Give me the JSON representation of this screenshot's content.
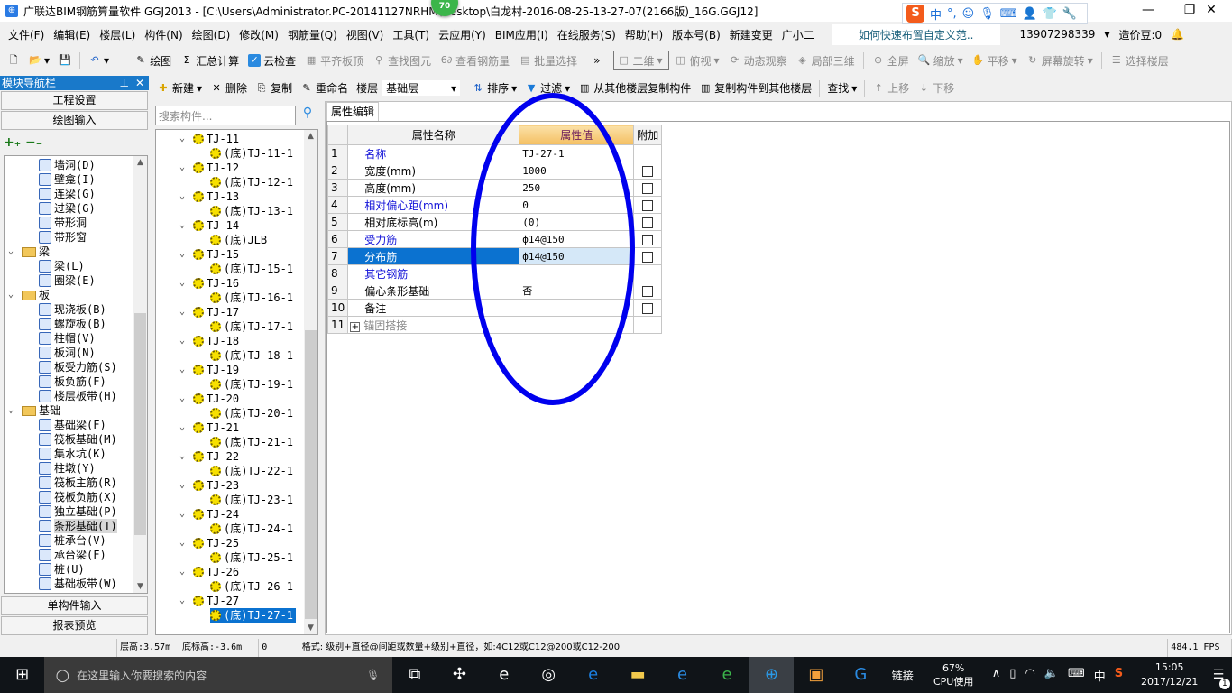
{
  "title": "广联达BIM钢筋算量软件 GGJ2013 - [C:\\Users\\Administrator.PC-20141127NRHM\\Desktop\\白龙村-2016-08-25-13-27-07(2166版)_16G.GGJ12]",
  "badge": "70",
  "ime": {
    "mode": "中",
    "punct": "°,"
  },
  "menu": [
    "文件(F)",
    "编辑(E)",
    "楼层(L)",
    "构件(N)",
    "绘图(D)",
    "修改(M)",
    "钢筋量(Q)",
    "视图(V)",
    "工具(T)",
    "云应用(Y)",
    "BIM应用(I)",
    "在线服务(S)",
    "帮助(H)",
    "版本号(B)",
    "新建变更",
    "广小二"
  ],
  "menu_tip": "如何快速布置自定义范..",
  "account": {
    "phone": "13907298339",
    "beans": "造价豆:0"
  },
  "toolbar1": {
    "draw": "绘图",
    "sum": "汇总计算",
    "cloudcheck": "云检查",
    "align": "平齐板顶",
    "find": "查找图元",
    "viewrebar": "查看钢筋量",
    "batch": "批量选择",
    "view2d": "二维",
    "top": "俯视",
    "dynamic": "动态观察",
    "local3d": "局部三维",
    "fullscreen": "全屏",
    "zoom": "缩放",
    "pan": "平移",
    "rotate": "屏幕旋转",
    "selfloor": "选择楼层"
  },
  "nav": {
    "title": "模块导航栏",
    "project": "工程设置",
    "drawing": "绘图输入",
    "single": "单构件输入",
    "report": "报表预览",
    "tree": [
      {
        "label": "墙洞(D)",
        "lvl": 2
      },
      {
        "label": "壁龛(I)",
        "lvl": 2
      },
      {
        "label": "连梁(G)",
        "lvl": 2
      },
      {
        "label": "过梁(G)",
        "lvl": 2
      },
      {
        "label": "带形洞",
        "lvl": 2
      },
      {
        "label": "带形窗",
        "lvl": 2
      },
      {
        "label": "梁",
        "lvl": 1
      },
      {
        "label": "梁(L)",
        "lvl": 2
      },
      {
        "label": "圈梁(E)",
        "lvl": 2
      },
      {
        "label": "板",
        "lvl": 1
      },
      {
        "label": "现浇板(B)",
        "lvl": 2
      },
      {
        "label": "螺旋板(B)",
        "lvl": 2
      },
      {
        "label": "柱帽(V)",
        "lvl": 2
      },
      {
        "label": "板洞(N)",
        "lvl": 2
      },
      {
        "label": "板受力筋(S)",
        "lvl": 2
      },
      {
        "label": "板负筋(F)",
        "lvl": 2
      },
      {
        "label": "楼层板带(H)",
        "lvl": 2
      },
      {
        "label": "基础",
        "lvl": 1
      },
      {
        "label": "基础梁(F)",
        "lvl": 2
      },
      {
        "label": "筏板基础(M)",
        "lvl": 2
      },
      {
        "label": "集水坑(K)",
        "lvl": 2
      },
      {
        "label": "柱墩(Y)",
        "lvl": 2
      },
      {
        "label": "筏板主筋(R)",
        "lvl": 2
      },
      {
        "label": "筏板负筋(X)",
        "lvl": 2
      },
      {
        "label": "独立基础(P)",
        "lvl": 2
      },
      {
        "label": "条形基础(T)",
        "lvl": 2,
        "selected": true
      },
      {
        "label": "桩承台(V)",
        "lvl": 2
      },
      {
        "label": "承台梁(F)",
        "lvl": 2
      },
      {
        "label": "桩(U)",
        "lvl": 2
      },
      {
        "label": "基础板带(W)",
        "lvl": 2
      }
    ]
  },
  "toolbar2": {
    "new": "新建",
    "delete": "删除",
    "copy": "复制",
    "rename": "重命名",
    "floor_label": "楼层",
    "floor": "基础层",
    "sort": "排序",
    "filter": "过滤",
    "copyfrom": "从其他楼层复制构件",
    "copyto": "复制构件到其他楼层",
    "find": "查找",
    "up": "上移",
    "down": "下移"
  },
  "search_placeholder": "搜索构件...",
  "components": [
    {
      "name": "TJ-11",
      "child": "(底)TJ-11-1"
    },
    {
      "name": "TJ-12",
      "child": "(底)TJ-12-1"
    },
    {
      "name": "TJ-13",
      "child": "(底)TJ-13-1"
    },
    {
      "name": "TJ-14",
      "child": "(底)JLB"
    },
    {
      "name": "TJ-15",
      "child": "(底)TJ-15-1"
    },
    {
      "name": "TJ-16",
      "child": "(底)TJ-16-1"
    },
    {
      "name": "TJ-17",
      "child": "(底)TJ-17-1"
    },
    {
      "name": "TJ-18",
      "child": "(底)TJ-18-1"
    },
    {
      "name": "TJ-19",
      "child": "(底)TJ-19-1"
    },
    {
      "name": "TJ-20",
      "child": "(底)TJ-20-1"
    },
    {
      "name": "TJ-21",
      "child": "(底)TJ-21-1"
    },
    {
      "name": "TJ-22",
      "child": "(底)TJ-22-1"
    },
    {
      "name": "TJ-23",
      "child": "(底)TJ-23-1"
    },
    {
      "name": "TJ-24",
      "child": "(底)TJ-24-1"
    },
    {
      "name": "TJ-25",
      "child": "(底)TJ-25-1"
    },
    {
      "name": "TJ-26",
      "child": "(底)TJ-26-1"
    },
    {
      "name": "TJ-27",
      "child": "(底)TJ-27-1",
      "selected": true
    }
  ],
  "props": {
    "tab": "属性编辑",
    "headers": [
      "属性名称",
      "属性值",
      "附加"
    ],
    "rows": [
      {
        "n": "1",
        "name": "名称",
        "value": "TJ-27-1",
        "blue": true,
        "cb": false
      },
      {
        "n": "2",
        "name": "宽度(mm)",
        "value": "1000",
        "cb": true
      },
      {
        "n": "3",
        "name": "高度(mm)",
        "value": "250",
        "cb": true
      },
      {
        "n": "4",
        "name": "相对偏心距(mm)",
        "value": "0",
        "blue": true,
        "cb": true
      },
      {
        "n": "5",
        "name": "相对底标高(m)",
        "value": "(0)",
        "cb": true
      },
      {
        "n": "6",
        "name": "受力筋",
        "value": "ф14@150",
        "blue": true,
        "cb": true
      },
      {
        "n": "7",
        "name": "分布筋",
        "value": "ф14@150",
        "cb": true,
        "selected": true
      },
      {
        "n": "8",
        "name": "其它钢筋",
        "value": "",
        "blue": true,
        "cb": false
      },
      {
        "n": "9",
        "name": "偏心条形基础",
        "value": "否",
        "cb": true
      },
      {
        "n": "10",
        "name": "备注",
        "value": "",
        "cb": true
      },
      {
        "n": "11",
        "name": "锚固搭接",
        "value": "",
        "gray": true,
        "cb": false,
        "expand": true
      }
    ]
  },
  "status": {
    "floor_height": "层高:3.57m",
    "bottom_elev": "底标高:-3.6m",
    "zero": "0",
    "hint": "格式: 级别+直径@间距或数量+级别+直径，如:4C12或C12@200或C12-200",
    "fps": "484.1 FPS"
  },
  "taskbar": {
    "search": "在这里输入你要搜索的内容",
    "link": "链接",
    "cpu_pct": "67%",
    "cpu_label": "CPU使用",
    "lang": "中",
    "time": "15:05",
    "date": "2017/12/21",
    "notif": "1"
  },
  "colors": {
    "nav_header": "#1979ca",
    "selected_row": "#0b72d0",
    "annotation": "#0000ee"
  }
}
